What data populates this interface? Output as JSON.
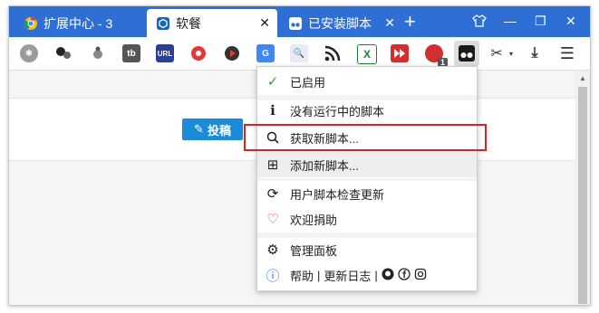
{
  "tabs": [
    {
      "title": "扩展中心 - 3",
      "active": false
    },
    {
      "title": "软餐",
      "active": true
    },
    {
      "title": "已安装脚本",
      "active": false
    }
  ],
  "page": {
    "submit_label": "投稿"
  },
  "menu": {
    "items": [
      {
        "label": "已启用",
        "icon": "check-icon"
      },
      {
        "label": "没有运行中的脚本",
        "icon": "info-icon"
      },
      {
        "label": "获取新脚本...",
        "icon": "search-icon"
      },
      {
        "label": "添加新脚本...",
        "icon": "plus-square-icon"
      },
      {
        "label": "用户脚本检查更新",
        "icon": "refresh-icon"
      },
      {
        "label": "欢迎捐助",
        "icon": "heart-icon"
      },
      {
        "label": "管理面板",
        "icon": "gear-icon"
      }
    ],
    "footer": {
      "help": "帮助",
      "sep": "|",
      "changelog": "更新日志",
      "sep2": "|"
    }
  },
  "toolbar": {
    "ext_labels": {
      "tb": "tb",
      "url": "URL",
      "x": "X",
      "g": "G"
    },
    "badge_count": "1"
  },
  "colors": {
    "tabstrip": "#2e6fd6",
    "accent_button": "#1a8bd8",
    "highlight_border": "#e02020",
    "check": "#2f9e44"
  }
}
